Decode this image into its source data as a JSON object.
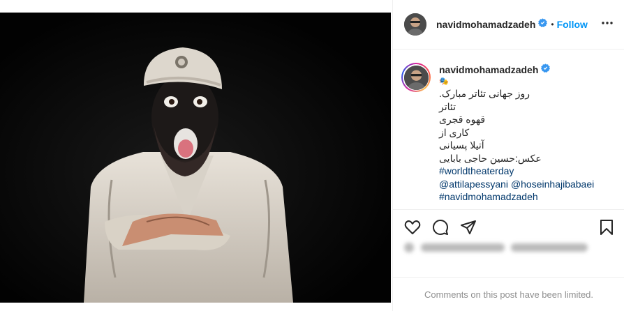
{
  "post": {
    "username": "navidmohamadzadeh",
    "separator": "•",
    "follow_label": "Follow",
    "caption": {
      "username": "navidmohamadzadeh",
      "lines": [
        "🎭",
        ".روز جهانی تئاتر مبارک",
        "تئاتر",
        "قهوه قجری",
        "کاری از",
        "آتیلا پسیانی",
        "عکس:حسین حاجی بابایی"
      ],
      "hashtag": "#worldtheaterday",
      "mention_1": "@attilapessyani",
      "mention_2": "@hoseinhajibabaei",
      "hashtag_2": "#navidmohamadzadeh"
    },
    "comments_notice": "Comments on this post have been limited."
  },
  "icons": {
    "verified": "verified-badge-icon",
    "more": "more-options-icon",
    "like": "heart-icon",
    "comment": "comment-icon",
    "share": "share-icon",
    "save": "bookmark-icon"
  },
  "colors": {
    "accent": "#0095f6",
    "verified": "#3897f0",
    "text": "#262626",
    "muted": "#8e8e8e",
    "link": "#00376b"
  }
}
